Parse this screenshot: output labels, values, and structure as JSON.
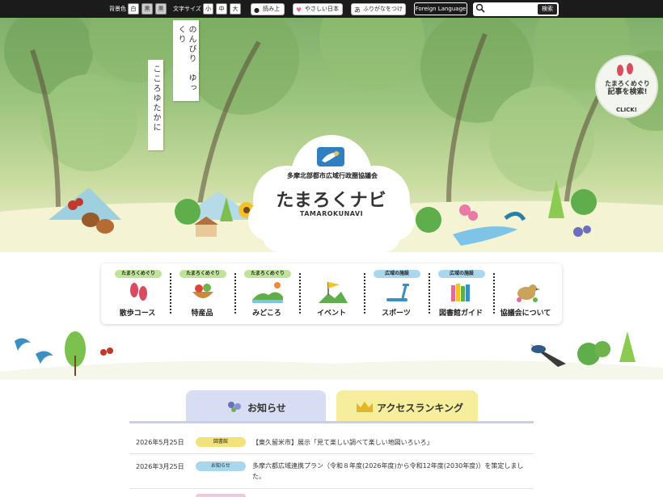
{
  "toolbar": {
    "bg_label": "背景色",
    "bg_options": [
      "白",
      "黒",
      "黒"
    ],
    "size_label": "文字サイズ",
    "size_options": [
      "小",
      "中",
      "大"
    ],
    "read_aloud": "読み上げ",
    "easy_japanese": "やさしい日本語",
    "furigana": "ふりがなをつける",
    "foreign_language": "Foreign Language",
    "search_placeholder": "",
    "search_button": "検索"
  },
  "hero": {
    "vertical_text_1": "のんびり　ゆっくり",
    "vertical_text_2": "こころゆたかに",
    "logo_org": "多摩北部都市広域行政圏協議会",
    "logo_main": "たまろくナビ",
    "logo_roman": "TAMAROKUNAVI",
    "search_bubble_line1": "たまろくめぐり",
    "search_bubble_line2": "記事を検索!",
    "search_bubble_click": "CLICK!"
  },
  "nav": [
    {
      "tag": "たまろくめぐり",
      "label": "散歩コース",
      "icon": "footprints-icon",
      "tag_color": "#bfe39a"
    },
    {
      "tag": "たまろくめぐり",
      "label": "特産品",
      "icon": "vegetables-icon",
      "tag_color": "#bfe39a"
    },
    {
      "tag": "たまろくめぐり",
      "label": "みどころ",
      "icon": "landscape-icon",
      "tag_color": "#bfe39a"
    },
    {
      "tag": "",
      "label": "イベント",
      "icon": "flag-icon",
      "tag_color": ""
    },
    {
      "tag": "広域の施設",
      "label": "スポーツ",
      "icon": "treadmill-icon",
      "tag_color": "#a9d8ee"
    },
    {
      "tag": "広域の施設",
      "label": "図書館ガイド",
      "icon": "books-icon",
      "tag_color": "#a9d8ee"
    },
    {
      "tag": "",
      "label": "協議会について",
      "icon": "bird-icon",
      "tag_color": ""
    }
  ],
  "tabs": {
    "news": "お知らせ",
    "ranking": "アクセスランキング"
  },
  "news": [
    {
      "date": "2026年5月25日",
      "badge": "図書館",
      "badge_color": "#f3e27a",
      "text": "【東久留米市】展示「見て楽しい調べて楽しい地図いろいろ」"
    },
    {
      "date": "2026年3月25日",
      "badge": "お知らせ",
      "badge_color": "#a9d8ee",
      "text": "多摩六都広域連携プラン（令和８年度(2026年度)から令和12年度(2030年度)）を策定しました。"
    }
  ],
  "colors": {
    "toolbar_bg": "#1b1b1b",
    "tab_news_bg": "#d7ddf2",
    "tab_ranking_bg": "#f6ee9c",
    "tab_underline": "#c8cfe6"
  }
}
